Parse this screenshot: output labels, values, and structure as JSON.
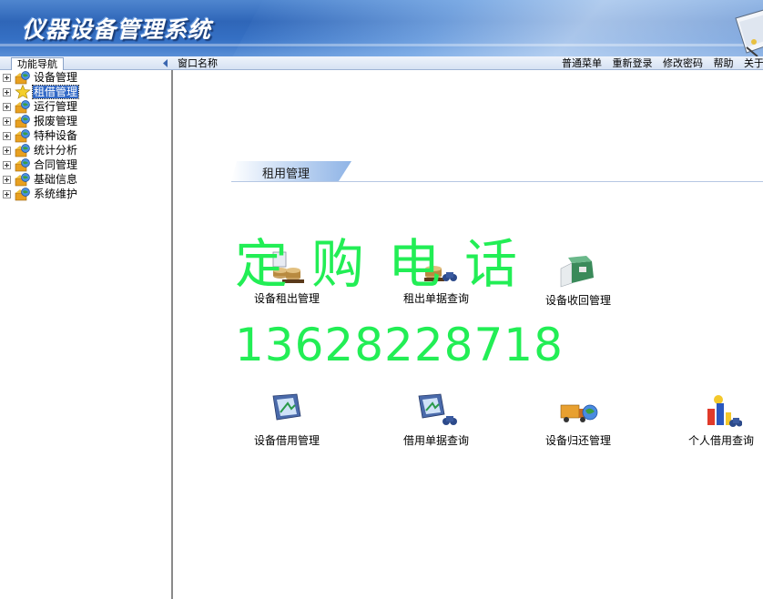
{
  "header": {
    "app_title": "仪器设备管理系统"
  },
  "toolbar": {
    "nav_tab_label": "功能导航",
    "window_name_label": "窗口名称",
    "menu": [
      "普通菜单",
      "重新登录",
      "修改密码",
      "帮助",
      "关于"
    ]
  },
  "sidebar": {
    "items": [
      {
        "label": "设备管理",
        "icon": "folder-globe-icon"
      },
      {
        "label": "租借管理",
        "icon": "star-icon",
        "selected": true
      },
      {
        "label": "运行管理",
        "icon": "folder-globe-icon"
      },
      {
        "label": "报废管理",
        "icon": "folder-globe-icon"
      },
      {
        "label": "特种设备",
        "icon": "folder-globe-icon"
      },
      {
        "label": "统计分析",
        "icon": "folder-globe-icon"
      },
      {
        "label": "合同管理",
        "icon": "folder-globe-icon"
      },
      {
        "label": "基础信息",
        "icon": "folder-globe-icon"
      },
      {
        "label": "系统维护",
        "icon": "folder-globe-icon"
      }
    ]
  },
  "main": {
    "section_title": "租用管理",
    "modules": [
      {
        "label": "设备租出管理",
        "icon": "rental-coins-icon"
      },
      {
        "label": "租出单据查询",
        "icon": "rental-query-icon"
      },
      {
        "label": "设备收回管理",
        "icon": "return-box-icon"
      },
      {
        "label": "设备借用管理",
        "icon": "borrow-folder-icon"
      },
      {
        "label": "借用单据查询",
        "icon": "borrow-query-icon"
      },
      {
        "label": "设备归还管理",
        "icon": "truck-globe-icon"
      },
      {
        "label": "个人借用查询",
        "icon": "personal-chart-icon"
      }
    ],
    "watermark": {
      "label": "定购电话",
      "number": "13628228718"
    }
  },
  "colors": {
    "banner": "#2f66b8",
    "selection": "#3168c6",
    "watermark": "#22ee55"
  }
}
